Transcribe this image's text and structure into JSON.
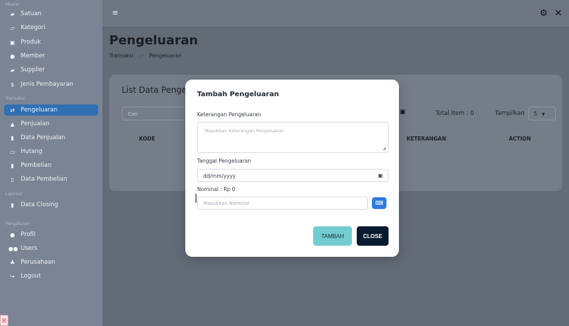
{
  "sidebar": {
    "section_master": "Master",
    "section_transaksi": "Transaksi",
    "section_laporan": "Laporan",
    "section_pengaturan": "Pengaturan",
    "items": [
      {
        "label": "Satuan",
        "icon": "folder-icon"
      },
      {
        "label": "Kategori",
        "icon": "folder-open-icon"
      },
      {
        "label": "Produk",
        "icon": "box-icon"
      },
      {
        "label": "Member",
        "icon": "user-icon"
      },
      {
        "label": "Supplier",
        "icon": "truck-icon"
      },
      {
        "label": "Jenis Pembayaran",
        "icon": "dollar-icon"
      },
      {
        "label": "Pengeluaran",
        "icon": "transfer-icon"
      },
      {
        "label": "Penjualan",
        "icon": "cart-icon"
      },
      {
        "label": "Data Penjualan",
        "icon": "report-icon"
      },
      {
        "label": "Hutang",
        "icon": "wallet-icon"
      },
      {
        "label": "Pembelian",
        "icon": "shopping-icon"
      },
      {
        "label": "Data Pembelian",
        "icon": "document-icon"
      },
      {
        "label": "Data Closing",
        "icon": "file-icon"
      },
      {
        "label": "Profil",
        "icon": "profile-icon"
      },
      {
        "label": "Users",
        "icon": "users-icon"
      },
      {
        "label": "Perusahaan",
        "icon": "company-icon"
      },
      {
        "label": "Logout",
        "icon": "logout-icon"
      }
    ]
  },
  "topbar": {
    "menu_icon": "menu-icon",
    "settings_icon": "gear-icon",
    "fullscreen_icon": "fullscreen-icon"
  },
  "page": {
    "title": "Pengeluaran",
    "breadcrumb_parent": "Transaksi",
    "breadcrumb_sep": ">",
    "breadcrumb_current": "Pengeluaran"
  },
  "list": {
    "title": "List Data Pengel",
    "search_placeholder": "Cari",
    "total_item": "Total Item : 0",
    "show_label": "Tampilkan",
    "show_value": "5",
    "columns": [
      "KODE",
      "KETERANGAN",
      "ACTION"
    ]
  },
  "modal": {
    "title": "Tambah Pengeluaran",
    "keterangan_label": "Keterangan Pengeluaran",
    "keterangan_placeholder": "Masukkan Keterangan Pengeluaran",
    "tanggal_label": "Tanggal Pengeluaran",
    "tanggal_value": "dd/mm/yyyy",
    "nominal_label": "Nominal : Rp 0",
    "nominal_placeholder": "Masukkan Nominal",
    "button_tambah": "TAMBAH",
    "button_close": "CLOSE"
  },
  "colors": {
    "active_sidebar": "#2f6fb3",
    "tambah_button": "#72cdd0",
    "close_button": "#071a30",
    "keyboard_button": "#2f79df"
  }
}
